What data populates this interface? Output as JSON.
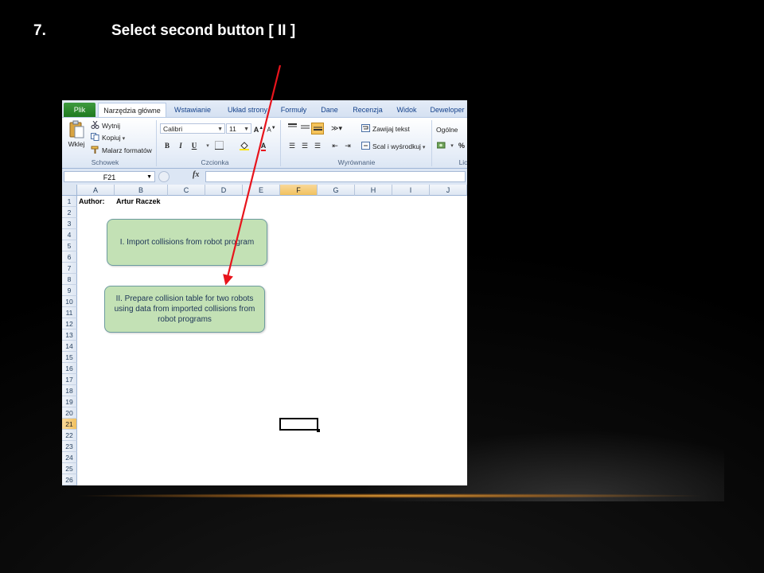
{
  "slide": {
    "step_number": "7.",
    "step_title": "Select second button [ II ]"
  },
  "ribbon": {
    "tabs": [
      "Plik",
      "Narzędzia główne",
      "Wstawianie",
      "Układ strony",
      "Formuły",
      "Dane",
      "Recenzja",
      "Widok",
      "Deweloper"
    ],
    "clipboard": {
      "paste": "Wklej",
      "cut": "Wytnij",
      "copy": "Kopiuj",
      "format_painter": "Malarz formatów",
      "group": "Schowek"
    },
    "font": {
      "name": "Calibri",
      "size": "11",
      "bold": "B",
      "italic": "I",
      "underline": "U",
      "group": "Czcionka"
    },
    "alignment": {
      "wrap_text": "Zawijaj tekst",
      "merge_center": "Scal i wyśrodkuj",
      "group": "Wyrównanie"
    },
    "number": {
      "format": "Ogólne",
      "percent": "%",
      "group": "Lic"
    }
  },
  "formula_bar": {
    "name_box": "F21",
    "fx": "fx",
    "value": ""
  },
  "sheet": {
    "columns": [
      "A",
      "B",
      "C",
      "D",
      "E",
      "F",
      "G",
      "H",
      "I",
      "J"
    ],
    "rows": [
      "1",
      "2",
      "3",
      "4",
      "5",
      "6",
      "7",
      "8",
      "9",
      "10",
      "11",
      "12",
      "13",
      "14",
      "15",
      "16",
      "17",
      "18",
      "19",
      "20",
      "21",
      "22",
      "23",
      "24",
      "25",
      "26"
    ],
    "selected_column": "F",
    "selected_row": "21",
    "cells": {
      "A1": "Author:",
      "B1": "Artur Raczek"
    }
  },
  "buttons": {
    "import": "I. Import collisions from robot program",
    "prepare": "II. Prepare collision table for two robots using data from imported collisions from robot programs"
  },
  "colors": {
    "arrow": "#e8141c",
    "button_fill": "#c3e1b5",
    "selected_header": "#f1c15f"
  }
}
